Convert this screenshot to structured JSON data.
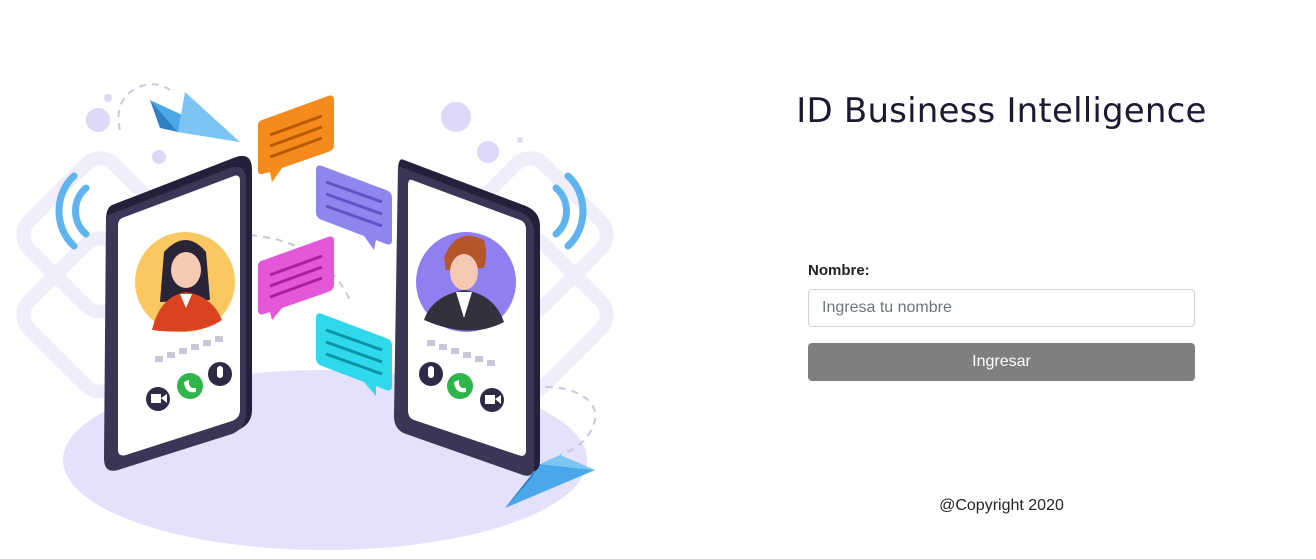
{
  "header": {
    "title": "ID Business Intelligence"
  },
  "form": {
    "name_label": "Nombre:",
    "name_input_placeholder": "Ingresa tu nombre",
    "name_input_value": "",
    "submit_label": "Ingresar"
  },
  "footer": {
    "copyright": "@Copyright 2020"
  },
  "colors": {
    "button_bg": "#7d7f81",
    "title_text": "#1c1a30",
    "illustration_floor": "#e4e1fb",
    "phone_frame": "#33304f"
  },
  "illustration": {
    "description_icons": [
      "paper-plane-icon",
      "chat-bubble-icon",
      "phone-call-icon",
      "signal-waves-icon",
      "video-camera-icon",
      "microphone-icon"
    ]
  }
}
